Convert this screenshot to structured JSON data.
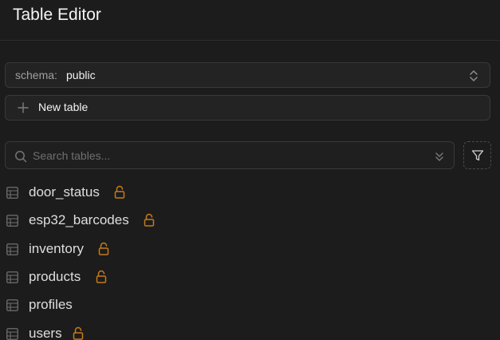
{
  "header": {
    "title": "Table Editor"
  },
  "schema": {
    "label": "schema:",
    "value": "public",
    "icon": "chevrons-up-down-icon"
  },
  "new_table": {
    "label": "New table",
    "icon": "plus-icon"
  },
  "search": {
    "placeholder": "Search tables...",
    "value": "",
    "icon": "search-icon",
    "dropdown_icon": "chevrons-down-icon"
  },
  "filter": {
    "icon": "filter-icon"
  },
  "tables": [
    {
      "name": "door_status",
      "rls_unlocked": true
    },
    {
      "name": "esp32_barcodes",
      "rls_unlocked": true
    },
    {
      "name": "inventory",
      "rls_unlocked": true
    },
    {
      "name": "products",
      "rls_unlocked": true
    },
    {
      "name": "profiles",
      "rls_unlocked": false
    },
    {
      "name": "users",
      "rls_unlocked": true
    }
  ],
  "colors": {
    "background": "#1c1c1c",
    "text": "#ededed",
    "muted_text": "#a0a0a0",
    "border": "#393939",
    "lock_accent": "#c47a1c"
  }
}
